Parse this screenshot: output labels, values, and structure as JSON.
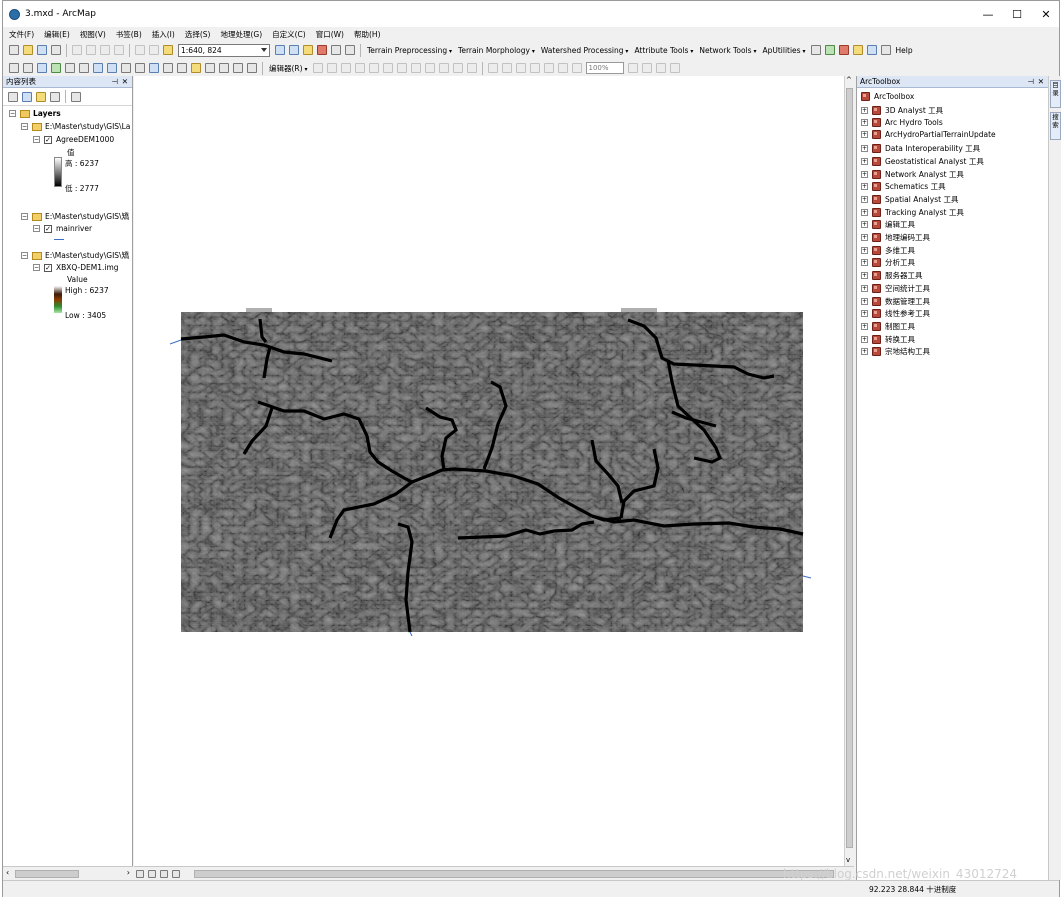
{
  "window": {
    "title": "3.mxd - ArcMap",
    "minimize": "—",
    "maximize": "☐",
    "close": "✕"
  },
  "menu": [
    "文件(F)",
    "编辑(E)",
    "视图(V)",
    "书签(B)",
    "插入(I)",
    "选择(S)",
    "地理处理(G)",
    "自定义(C)",
    "窗口(W)",
    "帮助(H)"
  ],
  "toolbar": {
    "scale_value": "1:640, 824",
    "terrain_preprocessing": "Terrain Preprocessing",
    "terrain_morphology": "Terrain Morphology",
    "watershed_processing": "Watershed Processing",
    "attribute_tools": "Attribute Tools",
    "network_tools": "Network Tools",
    "aputilities": "ApUtilities",
    "help": "Help",
    "editor": "编辑器(R)",
    "zoom_percent": "100%"
  },
  "toc": {
    "title": "内容列表",
    "layers_label": "Layers",
    "groups": [
      {
        "folder": "E:\\Master\\study\\GIS\\La",
        "layer": "AgreeDEM1000",
        "legend_title": "值",
        "high": "高 : 6237",
        "low": "低 : 2777"
      },
      {
        "folder": "E:\\Master\\study\\GIS\\矯",
        "layer": "mainriver"
      },
      {
        "folder": "E:\\Master\\study\\GIS\\矯",
        "layer": "XBXQ-DEM1.img",
        "legend_title": "Value",
        "high": "High : 6237",
        "low": "Low : 3405"
      }
    ]
  },
  "toolbox": {
    "title": "ArcToolbox",
    "root": "ArcToolbox",
    "items": [
      "3D Analyst 工具",
      "Arc Hydro Tools",
      "ArcHydroPartialTerrainUpdate",
      "Data Interoperability 工具",
      "Geostatistical Analyst 工具",
      "Network Analyst 工具",
      "Schematics 工具",
      "Spatial Analyst 工具",
      "Tracking Analyst 工具",
      "编辑工具",
      "地理编码工具",
      "多维工具",
      "分析工具",
      "服务器工具",
      "空间统计工具",
      "数据管理工具",
      "线性参考工具",
      "制图工具",
      "转换工具",
      "宗地结构工具"
    ]
  },
  "side_tabs": [
    "目录",
    "搜索"
  ],
  "status": {
    "coords": "92.223  28.844 十进制度"
  },
  "watermark": "https://blog.csdn.net/weixin_43012724",
  "icons": [
    "arcmap-app-icon",
    "new-icon",
    "open-icon",
    "save-icon",
    "print-icon",
    "cut-icon",
    "copy-icon",
    "paste-icon",
    "delete-icon",
    "undo-icon",
    "redo-icon",
    "add-data-icon",
    "zoom-in-icon",
    "zoom-out-icon",
    "pan-icon",
    "full-extent-icon",
    "select-icon",
    "identify-icon",
    "find-icon",
    "toolbox-icon",
    "pin-icon",
    "close-icon",
    "expand-icon",
    "folder-icon",
    "checkbox-icon"
  ]
}
